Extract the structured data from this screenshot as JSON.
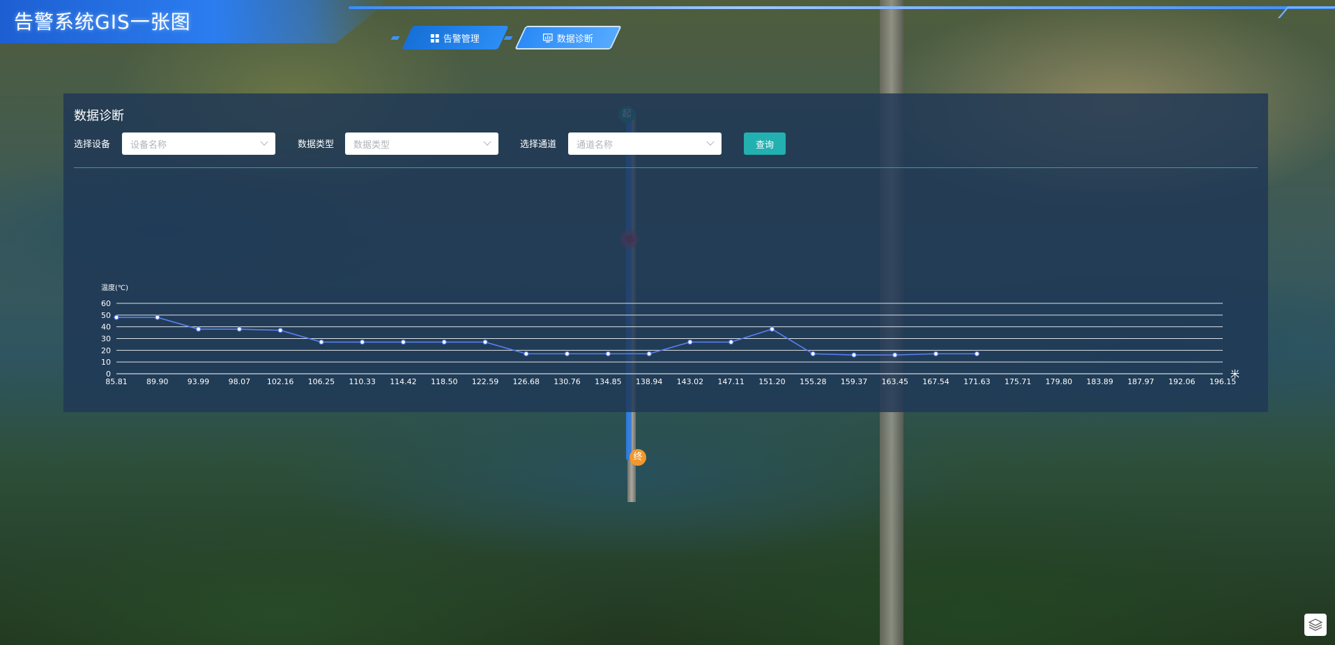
{
  "header": {
    "title": "告警系统GIS一张图",
    "tabs": [
      {
        "label": "告警管理",
        "icon": "grid-icon"
      },
      {
        "label": "数据诊断",
        "icon": "chart-monitor-icon",
        "active": true
      }
    ]
  },
  "map": {
    "start_label": "起",
    "end_label": "终"
  },
  "panel": {
    "title": "数据诊断",
    "filters": [
      {
        "label": "选择设备",
        "placeholder": "设备名称"
      },
      {
        "label": "数据类型",
        "placeholder": "数据类型"
      },
      {
        "label": "选择通道",
        "placeholder": "通道名称"
      }
    ],
    "query_label": "查询"
  },
  "chart_data": {
    "type": "line",
    "ylabel": "温度(℃)",
    "xunit": "米",
    "ylim": [
      0,
      60
    ],
    "yticks": [
      0,
      10,
      20,
      30,
      40,
      50,
      60
    ],
    "xticks": [
      "85.81",
      "89.90",
      "93.99",
      "98.07",
      "102.16",
      "106.25",
      "110.33",
      "114.42",
      "118.50",
      "122.59",
      "126.68",
      "130.76",
      "134.85",
      "138.94",
      "143.02",
      "147.11",
      "151.20",
      "155.28",
      "159.37",
      "163.45",
      "167.54",
      "171.63",
      "175.71",
      "179.80",
      "183.89",
      "187.97",
      "192.06",
      "196.15"
    ],
    "xlim": [
      85.81,
      196.15
    ],
    "series": [
      {
        "color": "#5b7ff0",
        "x": [
          85.81,
          89.9,
          93.99,
          98.07,
          102.16,
          106.25,
          110.33,
          114.42,
          118.5,
          122.59,
          126.68,
          130.76,
          134.85,
          138.94,
          143.02,
          147.11,
          151.2,
          155.28,
          159.37,
          163.45,
          167.54,
          171.63
        ],
        "y": [
          48,
          48,
          38,
          38,
          37,
          27,
          27,
          27,
          27,
          27,
          17,
          17,
          17,
          17,
          27,
          27,
          38,
          17,
          16,
          16,
          17,
          17
        ]
      }
    ],
    "grid": true,
    "zoom_range": [
      0.3,
      0.7
    ]
  }
}
